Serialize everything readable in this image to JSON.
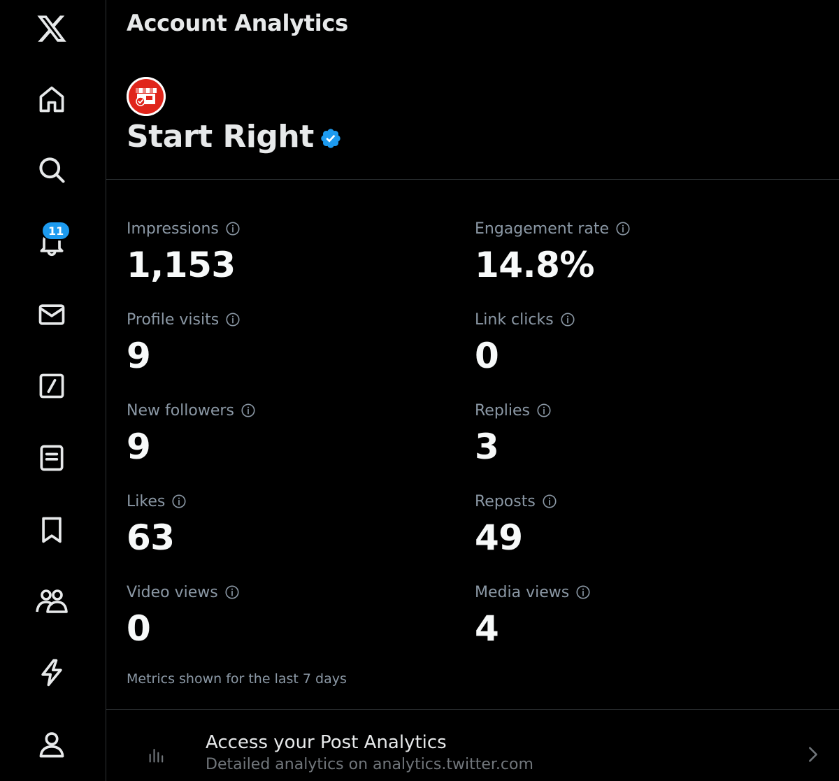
{
  "sidebar": {
    "items": [
      {
        "icon": "x-logo-icon"
      },
      {
        "icon": "home-icon"
      },
      {
        "icon": "search-icon"
      },
      {
        "icon": "bell-icon",
        "badge": "11"
      },
      {
        "icon": "envelope-icon"
      },
      {
        "icon": "grok-icon"
      },
      {
        "icon": "lists-icon"
      },
      {
        "icon": "bookmark-icon"
      },
      {
        "icon": "communities-icon"
      },
      {
        "icon": "lightning-icon"
      },
      {
        "icon": "profile-icon"
      }
    ]
  },
  "page": {
    "title": "Account Analytics"
  },
  "account": {
    "name": "Start Right",
    "verified": true,
    "avatar_icon": "storefront-icon",
    "verified_color": "#1d9bf0"
  },
  "metrics": {
    "impressions": {
      "label": "Impressions",
      "value": "1,153"
    },
    "engagement_rate": {
      "label": "Engagement rate",
      "value": "14.8%"
    },
    "profile_visits": {
      "label": "Profile visits",
      "value": "9"
    },
    "link_clicks": {
      "label": "Link clicks",
      "value": "0"
    },
    "new_followers": {
      "label": "New followers",
      "value": "9"
    },
    "replies": {
      "label": "Replies",
      "value": "3"
    },
    "likes": {
      "label": "Likes",
      "value": "63"
    },
    "reposts": {
      "label": "Reposts",
      "value": "49"
    },
    "video_views": {
      "label": "Video views",
      "value": "0"
    },
    "media_views": {
      "label": "Media views",
      "value": "4"
    }
  },
  "footnote": "Metrics shown for the last 7 days",
  "post_analytics": {
    "title": "Access your Post Analytics",
    "subtitle": "Detailed analytics on analytics.twitter.com",
    "icon": "bar-chart-icon"
  },
  "colors": {
    "background": "#000000",
    "accent": "#1d9bf0",
    "avatar_red": "#e0251b"
  }
}
